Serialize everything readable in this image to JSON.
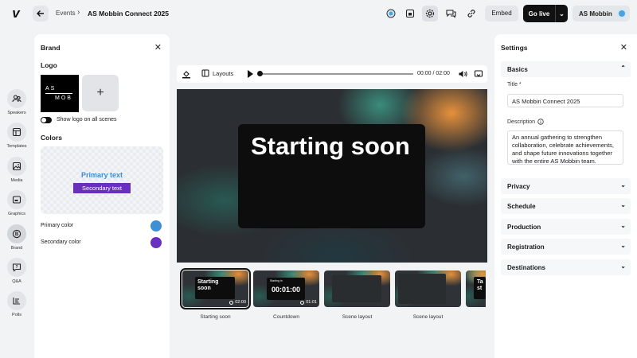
{
  "topbar": {
    "breadcrumb_root": "Events",
    "breadcrumb_sep": "›",
    "event_title": "AS Mobbin Connect 2025",
    "embed_label": "Embed",
    "golive_label": "Go live",
    "account_label": "AS Mobbin",
    "icons": [
      "status-icon",
      "layout-icon",
      "settings-icon",
      "chat-icon",
      "link-icon"
    ]
  },
  "rail": {
    "items": [
      {
        "label": "Speakers",
        "icon": "speakers-icon"
      },
      {
        "label": "Templates",
        "icon": "templates-icon"
      },
      {
        "label": "Media",
        "icon": "media-icon"
      },
      {
        "label": "Graphics",
        "icon": "graphics-icon"
      },
      {
        "label": "Brand",
        "icon": "brand-icon"
      },
      {
        "label": "Q&A",
        "icon": "qa-icon"
      },
      {
        "label": "Polls",
        "icon": "polls-icon"
      }
    ]
  },
  "brand": {
    "title": "Brand",
    "logo_section": "Logo",
    "logo_text_top": "AS",
    "logo_text_bottom": "MOB",
    "show_logo_label": "Show logo on all scenes",
    "colors_section": "Colors",
    "preview_primary": "Primary text",
    "preview_secondary": "Secondary text",
    "primary_color_label": "Primary color",
    "secondary_color_label": "Secondary color",
    "primary_color": "#3d8fd6",
    "secondary_color": "#6a2fc0"
  },
  "stage": {
    "layouts_label": "Layouts",
    "time": "00:00 / 02:00",
    "playback_progress": 0,
    "title": "Starting soon"
  },
  "scenes": [
    {
      "label": "Starting soon",
      "card_text": "Starting soon",
      "time": "02:00"
    },
    {
      "label": "Countdown",
      "card_kicker": "Starting in",
      "card_text": "00:01:00",
      "time": "01:01"
    },
    {
      "label": "Scene layout"
    },
    {
      "label": "Scene layout"
    },
    {
      "card_text": "Ta st"
    }
  ],
  "settings": {
    "title": "Settings",
    "basics": "Basics",
    "title_label": "Title *",
    "title_value": "AS Mobbin Connect 2025",
    "description_label": "Description",
    "description_value": "An annual gathering to strengthen collaboration, celebrate achievements, and shape future innovations together with the entire AS Mobbin team.",
    "sections": [
      "Privacy",
      "Schedule",
      "Production",
      "Registration",
      "Destinations"
    ]
  }
}
